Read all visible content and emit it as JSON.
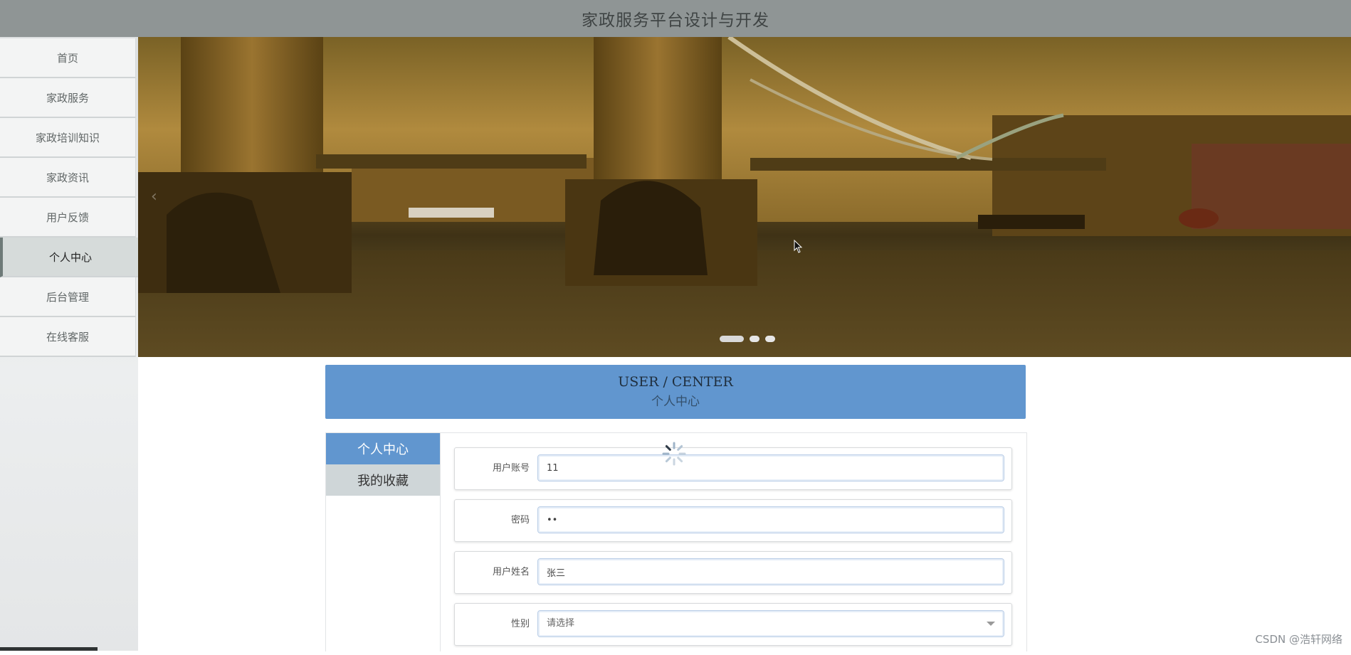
{
  "header": {
    "title": "家政服务平台设计与开发"
  },
  "sidebar": {
    "items": [
      {
        "label": "首页",
        "active": false
      },
      {
        "label": "家政服务",
        "active": false
      },
      {
        "label": "家政培训知识",
        "active": false
      },
      {
        "label": "家政资讯",
        "active": false
      },
      {
        "label": "用户反馈",
        "active": false
      },
      {
        "label": "个人中心",
        "active": true
      },
      {
        "label": "后台管理",
        "active": false
      },
      {
        "label": "在线客服",
        "active": false
      }
    ]
  },
  "banner": {
    "arrow": "‹",
    "slide_count": 3,
    "active_slide": 1
  },
  "center": {
    "en": "USER / CENTER",
    "zh": "个人中心"
  },
  "tabs": [
    {
      "label": "个人中心",
      "active": true
    },
    {
      "label": "我的收藏",
      "active": false
    }
  ],
  "form": {
    "account_label": "用户账号",
    "account_value": "11",
    "password_label": "密码",
    "password_value": "••",
    "name_label": "用户姓名",
    "name_value": "张三",
    "gender_label": "性别",
    "gender_placeholder": "请选择"
  },
  "watermark": "CSDN @浩轩网络",
  "colors": {
    "topbar": "#8f9595",
    "accent": "#6196cf"
  }
}
